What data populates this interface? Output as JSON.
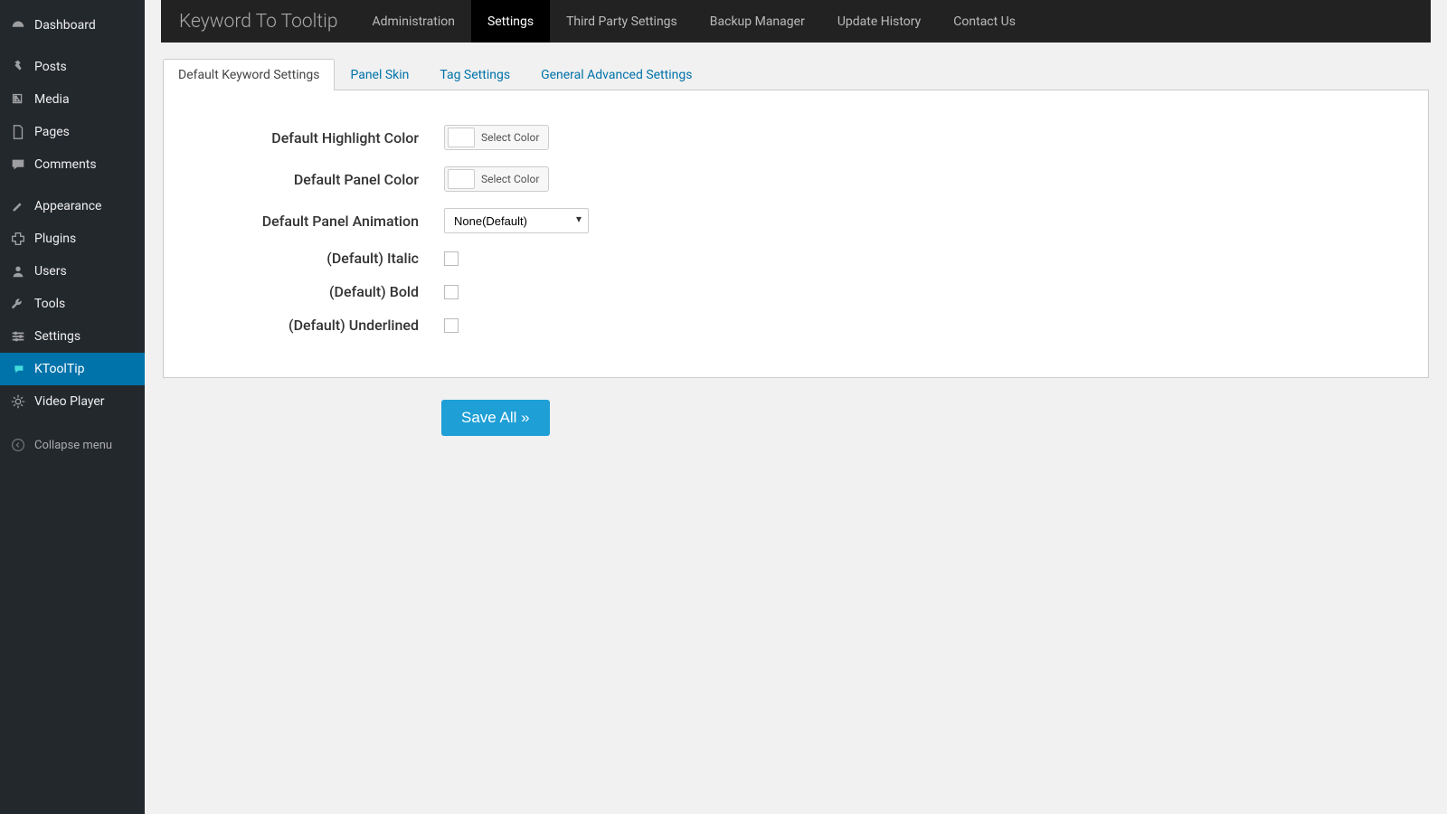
{
  "sidebar": {
    "items": [
      {
        "icon": "dashboard",
        "label": "Dashboard"
      },
      {
        "icon": "pin",
        "label": "Posts"
      },
      {
        "icon": "media",
        "label": "Media"
      },
      {
        "icon": "page",
        "label": "Pages"
      },
      {
        "icon": "comment",
        "label": "Comments"
      },
      {
        "icon": "appearance",
        "label": "Appearance"
      },
      {
        "icon": "plugin",
        "label": "Plugins"
      },
      {
        "icon": "users",
        "label": "Users"
      },
      {
        "icon": "tools",
        "label": "Tools"
      },
      {
        "icon": "settings",
        "label": "Settings"
      },
      {
        "icon": "tooltip",
        "label": "KToolTip",
        "active": true
      },
      {
        "icon": "video",
        "label": "Video Player"
      }
    ],
    "collapse": "Collapse menu"
  },
  "topbar": {
    "title": "Keyword To Tooltip",
    "items": [
      {
        "label": "Administration"
      },
      {
        "label": "Settings",
        "active": true
      },
      {
        "label": "Third Party Settings"
      },
      {
        "label": "Backup Manager"
      },
      {
        "label": "Update History"
      },
      {
        "label": "Contact Us"
      }
    ]
  },
  "tabs": [
    {
      "label": "Default Keyword Settings",
      "active": true
    },
    {
      "label": "Panel Skin"
    },
    {
      "label": "Tag Settings"
    },
    {
      "label": "General Advanced Settings"
    }
  ],
  "form": {
    "highlight_label": "Default Highlight Color",
    "panelcolor_label": "Default Panel Color",
    "selectcolor": "Select Color",
    "animation_label": "Default Panel Animation",
    "animation_value": "None(Default)",
    "italic_label": "(Default) Italic",
    "bold_label": "(Default) Bold",
    "underlined_label": "(Default) Underlined",
    "save": "Save All »"
  }
}
